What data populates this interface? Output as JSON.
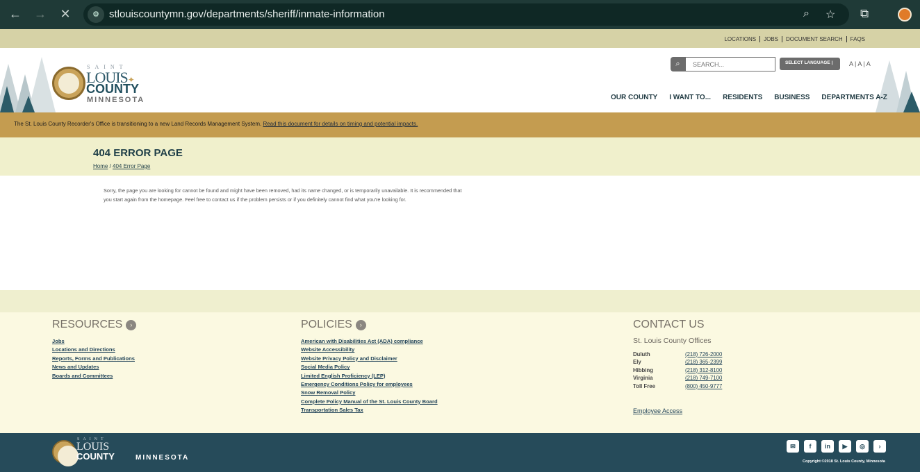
{
  "browser": {
    "url": "stlouiscountymn.gov/departments/sheriff/inmate-information",
    "icons": [
      "back-arrow-icon",
      "forward-arrow-icon",
      "stop-loading-icon",
      "site-settings-icon",
      "zoom-icon",
      "bookmark-star-icon",
      "extensions-icon",
      "profile-avatar"
    ]
  },
  "utility_links": [
    "LOCATIONS",
    "JOBS",
    "DOCUMENT SEARCH",
    "FAQS"
  ],
  "logo": {
    "saint": "SAINT",
    "louis": "LOUIS",
    "county": "COUNTY",
    "state": "MINNESOTA",
    "seal_text": "SAINT LOUIS"
  },
  "search": {
    "placeholder": "SEARCH..."
  },
  "language": {
    "label": "SELECT LANGUAGE |"
  },
  "font_size": {
    "label": "A | A | A"
  },
  "main_nav": [
    "OUR COUNTY",
    "I WANT TO...",
    "RESIDENTS",
    "BUSINESS",
    "DEPARTMENTS A-Z"
  ],
  "banner": {
    "text": "The St. Louis County Recorder's Office is transitioning to a new Land Records Management System. ",
    "link": "Read this document for details on timing and potential impacts."
  },
  "page": {
    "title": "404 ERROR PAGE",
    "breadcrumb": {
      "home": "Home",
      "sep": " / ",
      "current": "404 Error Page"
    },
    "body": "Sorry, the page you are looking for cannot be found and might have been removed, had its name changed, or is temporarily unavailable. It is recommended that you start again from the homepage. Feel free to contact us if the problem persists or if you definitely cannot find what you're looking for."
  },
  "footer": {
    "resources": {
      "title": "RESOURCES",
      "links": [
        "Jobs",
        "Locations and Directions",
        "Reports, Forms and Publications",
        "News and Updates",
        "Boards and Committees"
      ]
    },
    "policies": {
      "title": "POLICIES",
      "links": [
        "American with Disabilities Act (ADA) compliance",
        "Website Accessibility",
        "Website Privacy Policy and Disclaimer",
        "Social Media Policy",
        "Limited English Proficiency (LEP)",
        "Emergency Conditions Policy for employees",
        "Snow Removal Policy",
        "Complete Policy Manual of the St. Louis County Board",
        "Transportation Sales Tax"
      ]
    },
    "contact": {
      "title": "CONTACT US",
      "subtitle": "St. Louis County Offices",
      "phones": [
        {
          "city": "Duluth",
          "number": "(218) 726-2000"
        },
        {
          "city": "Ely",
          "number": "(218) 365-2399"
        },
        {
          "city": "Hibbing",
          "number": "(218) 312-8100"
        },
        {
          "city": "Virginia",
          "number": "(218) 749-7100"
        },
        {
          "city": "Toll Free",
          "number": "(800) 450-9777"
        }
      ],
      "employee_access": "Employee Access"
    }
  },
  "bottom": {
    "social": [
      "email-icon",
      "facebook-icon",
      "linkedin-icon",
      "youtube-icon",
      "instagram-icon",
      "more-icon"
    ],
    "copyright": "Copyright ©2018 St. Louis County, Minnesota"
  },
  "colors": {
    "dark_teal": "#264b5a",
    "gold": "#c49c50",
    "cream": "#fbf9e1",
    "khaki": "#d6d2a6"
  }
}
